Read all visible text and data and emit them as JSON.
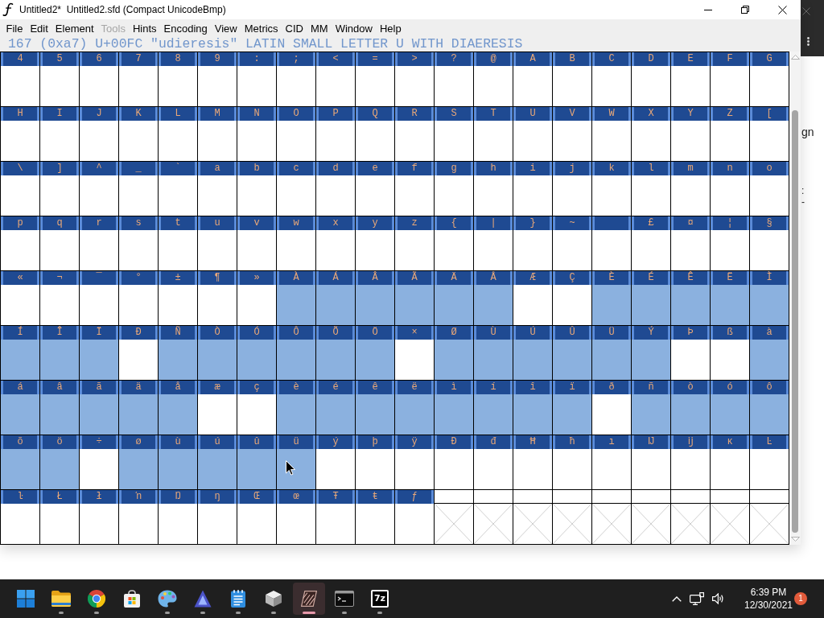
{
  "window": {
    "title": "Untitled2*  Untitled2.sfd (Compact UnicodeBmp)"
  },
  "menu": [
    {
      "label": "File",
      "disabled": false
    },
    {
      "label": "Edit",
      "disabled": false
    },
    {
      "label": "Element",
      "disabled": false
    },
    {
      "label": "Tools",
      "disabled": true
    },
    {
      "label": "Hints",
      "disabled": false
    },
    {
      "label": "Encoding",
      "disabled": false
    },
    {
      "label": "View",
      "disabled": false
    },
    {
      "label": "Metrics",
      "disabled": false
    },
    {
      "label": "CID",
      "disabled": false
    },
    {
      "label": "MM",
      "disabled": false
    },
    {
      "label": "Window",
      "disabled": false
    },
    {
      "label": "Help",
      "disabled": false
    }
  ],
  "glyph_info": "167 (0xa7) U+00FC \"udieresis\" LATIN SMALL LETTER U WITH DIAERESIS",
  "glyph_grid": {
    "rows": [
      {
        "cells": [
          {
            "kind": "glyph",
            "label": "4",
            "selected": false
          },
          {
            "kind": "glyph",
            "label": "5",
            "selected": false
          },
          {
            "kind": "glyph",
            "label": "6",
            "selected": false
          },
          {
            "kind": "glyph",
            "label": "7",
            "selected": false
          },
          {
            "kind": "glyph",
            "label": "8",
            "selected": false
          },
          {
            "kind": "glyph",
            "label": "9",
            "selected": false
          },
          {
            "kind": "glyph",
            "label": ":",
            "selected": false
          },
          {
            "kind": "glyph",
            "label": ";",
            "selected": false
          },
          {
            "kind": "glyph",
            "label": "<",
            "selected": false
          },
          {
            "kind": "glyph",
            "label": "=",
            "selected": false
          },
          {
            "kind": "glyph",
            "label": ">",
            "selected": false
          },
          {
            "kind": "glyph",
            "label": "?",
            "selected": false
          },
          {
            "kind": "glyph",
            "label": "@",
            "selected": false
          },
          {
            "kind": "glyph",
            "label": "A",
            "selected": false
          },
          {
            "kind": "glyph",
            "label": "B",
            "selected": false
          },
          {
            "kind": "glyph",
            "label": "C",
            "selected": false
          },
          {
            "kind": "glyph",
            "label": "D",
            "selected": false
          },
          {
            "kind": "glyph",
            "label": "E",
            "selected": false
          },
          {
            "kind": "glyph",
            "label": "F",
            "selected": false
          },
          {
            "kind": "glyph",
            "label": "G",
            "selected": false
          }
        ]
      },
      {
        "cells": [
          {
            "kind": "glyph",
            "label": "H",
            "selected": false
          },
          {
            "kind": "glyph",
            "label": "I",
            "selected": false
          },
          {
            "kind": "glyph",
            "label": "J",
            "selected": false
          },
          {
            "kind": "glyph",
            "label": "K",
            "selected": false
          },
          {
            "kind": "glyph",
            "label": "L",
            "selected": false
          },
          {
            "kind": "glyph",
            "label": "M",
            "selected": false
          },
          {
            "kind": "glyph",
            "label": "N",
            "selected": false
          },
          {
            "kind": "glyph",
            "label": "O",
            "selected": false
          },
          {
            "kind": "glyph",
            "label": "P",
            "selected": false
          },
          {
            "kind": "glyph",
            "label": "Q",
            "selected": false
          },
          {
            "kind": "glyph",
            "label": "R",
            "selected": false
          },
          {
            "kind": "glyph",
            "label": "S",
            "selected": false
          },
          {
            "kind": "glyph",
            "label": "T",
            "selected": false
          },
          {
            "kind": "glyph",
            "label": "U",
            "selected": false
          },
          {
            "kind": "glyph",
            "label": "V",
            "selected": false
          },
          {
            "kind": "glyph",
            "label": "W",
            "selected": false
          },
          {
            "kind": "glyph",
            "label": "X",
            "selected": false
          },
          {
            "kind": "glyph",
            "label": "Y",
            "selected": false
          },
          {
            "kind": "glyph",
            "label": "Z",
            "selected": false
          },
          {
            "kind": "glyph",
            "label": "[",
            "selected": false
          }
        ]
      },
      {
        "cells": [
          {
            "kind": "glyph",
            "label": "\\",
            "selected": false
          },
          {
            "kind": "glyph",
            "label": "]",
            "selected": false
          },
          {
            "kind": "glyph",
            "label": "^",
            "selected": false
          },
          {
            "kind": "glyph",
            "label": "_",
            "selected": false
          },
          {
            "kind": "glyph",
            "label": "`",
            "selected": false
          },
          {
            "kind": "glyph",
            "label": "a",
            "selected": false
          },
          {
            "kind": "glyph",
            "label": "b",
            "selected": false
          },
          {
            "kind": "glyph",
            "label": "c",
            "selected": false
          },
          {
            "kind": "glyph",
            "label": "d",
            "selected": false
          },
          {
            "kind": "glyph",
            "label": "e",
            "selected": false
          },
          {
            "kind": "glyph",
            "label": "f",
            "selected": false
          },
          {
            "kind": "glyph",
            "label": "g",
            "selected": false
          },
          {
            "kind": "glyph",
            "label": "h",
            "selected": false
          },
          {
            "kind": "glyph",
            "label": "i",
            "selected": false
          },
          {
            "kind": "glyph",
            "label": "j",
            "selected": false
          },
          {
            "kind": "glyph",
            "label": "k",
            "selected": false
          },
          {
            "kind": "glyph",
            "label": "l",
            "selected": false
          },
          {
            "kind": "glyph",
            "label": "m",
            "selected": false
          },
          {
            "kind": "glyph",
            "label": "n",
            "selected": false
          },
          {
            "kind": "glyph",
            "label": "o",
            "selected": false
          }
        ]
      },
      {
        "cells": [
          {
            "kind": "glyph",
            "label": "p",
            "selected": false
          },
          {
            "kind": "glyph",
            "label": "q",
            "selected": false
          },
          {
            "kind": "glyph",
            "label": "r",
            "selected": false
          },
          {
            "kind": "glyph",
            "label": "s",
            "selected": false
          },
          {
            "kind": "glyph",
            "label": "t",
            "selected": false
          },
          {
            "kind": "glyph",
            "label": "u",
            "selected": false
          },
          {
            "kind": "glyph",
            "label": "v",
            "selected": false
          },
          {
            "kind": "glyph",
            "label": "w",
            "selected": false
          },
          {
            "kind": "glyph",
            "label": "x",
            "selected": false
          },
          {
            "kind": "glyph",
            "label": "y",
            "selected": false
          },
          {
            "kind": "glyph",
            "label": "z",
            "selected": false
          },
          {
            "kind": "glyph",
            "label": "{",
            "selected": false
          },
          {
            "kind": "glyph",
            "label": "|",
            "selected": false
          },
          {
            "kind": "glyph",
            "label": "}",
            "selected": false
          },
          {
            "kind": "glyph",
            "label": "~",
            "selected": false
          },
          {
            "kind": "glyph",
            "selected": false
          },
          {
            "kind": "glyph",
            "label": "£",
            "selected": false
          },
          {
            "kind": "glyph",
            "label": "¤",
            "selected": false
          },
          {
            "kind": "glyph",
            "label": "¦",
            "selected": false
          },
          {
            "kind": "glyph",
            "label": "§",
            "selected": false
          }
        ]
      },
      {
        "cells": [
          {
            "kind": "glyph",
            "label": "«",
            "selected": false
          },
          {
            "kind": "glyph",
            "label": "¬",
            "selected": false
          },
          {
            "kind": "glyph",
            "label": "¯",
            "selected": false
          },
          {
            "kind": "glyph",
            "label": "°",
            "selected": false
          },
          {
            "kind": "glyph",
            "label": "±",
            "selected": false
          },
          {
            "kind": "glyph",
            "label": "¶",
            "selected": false
          },
          {
            "kind": "glyph",
            "label": "»",
            "selected": false
          },
          {
            "kind": "glyph",
            "label": "À",
            "selected": true
          },
          {
            "kind": "glyph",
            "label": "Á",
            "selected": true
          },
          {
            "kind": "glyph",
            "label": "Â",
            "selected": true
          },
          {
            "kind": "glyph",
            "label": "Ã",
            "selected": true
          },
          {
            "kind": "glyph",
            "label": "Ä",
            "selected": true
          },
          {
            "kind": "glyph",
            "label": "Å",
            "selected": true
          },
          {
            "kind": "glyph",
            "label": "Æ",
            "selected": false
          },
          {
            "kind": "glyph",
            "label": "Ç",
            "selected": false
          },
          {
            "kind": "glyph",
            "label": "È",
            "selected": true
          },
          {
            "kind": "glyph",
            "label": "É",
            "selected": true
          },
          {
            "kind": "glyph",
            "label": "Ê",
            "selected": true
          },
          {
            "kind": "glyph",
            "label": "Ë",
            "selected": true
          },
          {
            "kind": "glyph",
            "label": "Ì",
            "selected": true
          }
        ]
      },
      {
        "cells": [
          {
            "kind": "glyph",
            "label": "Í",
            "selected": true
          },
          {
            "kind": "glyph",
            "label": "Î",
            "selected": true
          },
          {
            "kind": "glyph",
            "label": "Ï",
            "selected": true
          },
          {
            "kind": "glyph",
            "label": "Ð",
            "selected": false
          },
          {
            "kind": "glyph",
            "label": "Ñ",
            "selected": true
          },
          {
            "kind": "glyph",
            "label": "Ò",
            "selected": true
          },
          {
            "kind": "glyph",
            "label": "Ó",
            "selected": true
          },
          {
            "kind": "glyph",
            "label": "Ô",
            "selected": true
          },
          {
            "kind": "glyph",
            "label": "Õ",
            "selected": true
          },
          {
            "kind": "glyph",
            "label": "Ö",
            "selected": true
          },
          {
            "kind": "glyph",
            "label": "×",
            "selected": false
          },
          {
            "kind": "glyph",
            "label": "Ø",
            "selected": true
          },
          {
            "kind": "glyph",
            "label": "Ù",
            "selected": true
          },
          {
            "kind": "glyph",
            "label": "Ú",
            "selected": true
          },
          {
            "kind": "glyph",
            "label": "Û",
            "selected": true
          },
          {
            "kind": "glyph",
            "label": "Ü",
            "selected": true
          },
          {
            "kind": "glyph",
            "label": "Ý",
            "selected": true
          },
          {
            "kind": "glyph",
            "label": "Þ",
            "selected": false
          },
          {
            "kind": "glyph",
            "label": "ß",
            "selected": false
          },
          {
            "kind": "glyph",
            "label": "à",
            "selected": true
          }
        ]
      },
      {
        "cells": [
          {
            "kind": "glyph",
            "label": "á",
            "selected": true
          },
          {
            "kind": "glyph",
            "label": "â",
            "selected": true
          },
          {
            "kind": "glyph",
            "label": "ã",
            "selected": true
          },
          {
            "kind": "glyph",
            "label": "ä",
            "selected": true
          },
          {
            "kind": "glyph",
            "label": "å",
            "selected": true
          },
          {
            "kind": "glyph",
            "label": "æ",
            "selected": false
          },
          {
            "kind": "glyph",
            "label": "ç",
            "selected": false
          },
          {
            "kind": "glyph",
            "label": "è",
            "selected": true
          },
          {
            "kind": "glyph",
            "label": "é",
            "selected": true
          },
          {
            "kind": "glyph",
            "label": "ê",
            "selected": true
          },
          {
            "kind": "glyph",
            "label": "ë",
            "selected": true
          },
          {
            "kind": "glyph",
            "label": "ì",
            "selected": true
          },
          {
            "kind": "glyph",
            "label": "í",
            "selected": true
          },
          {
            "kind": "glyph",
            "label": "î",
            "selected": true
          },
          {
            "kind": "glyph",
            "label": "ï",
            "selected": true
          },
          {
            "kind": "glyph",
            "label": "ð",
            "selected": false
          },
          {
            "kind": "glyph",
            "label": "ñ",
            "selected": true
          },
          {
            "kind": "glyph",
            "label": "ò",
            "selected": true
          },
          {
            "kind": "glyph",
            "label": "ó",
            "selected": true
          },
          {
            "kind": "glyph",
            "label": "ô",
            "selected": true
          }
        ]
      },
      {
        "cells": [
          {
            "kind": "glyph",
            "label": "õ",
            "selected": true
          },
          {
            "kind": "glyph",
            "label": "ö",
            "selected": true
          },
          {
            "kind": "glyph",
            "label": "÷",
            "selected": false
          },
          {
            "kind": "glyph",
            "label": "ø",
            "selected": true
          },
          {
            "kind": "glyph",
            "label": "ù",
            "selected": true
          },
          {
            "kind": "glyph",
            "label": "ú",
            "selected": true
          },
          {
            "kind": "glyph",
            "label": "û",
            "selected": true
          },
          {
            "kind": "glyph",
            "label": "ü",
            "selected": true
          },
          {
            "kind": "glyph",
            "label": "ý",
            "selected": false
          },
          {
            "kind": "glyph",
            "label": "þ",
            "selected": false
          },
          {
            "kind": "glyph",
            "label": "ÿ",
            "selected": false
          },
          {
            "kind": "glyph",
            "label": "Đ",
            "selected": false
          },
          {
            "kind": "glyph",
            "label": "đ",
            "selected": false
          },
          {
            "kind": "glyph",
            "label": "Ħ",
            "selected": false
          },
          {
            "kind": "glyph",
            "label": "ħ",
            "selected": false
          },
          {
            "kind": "glyph",
            "label": "ı",
            "selected": false
          },
          {
            "kind": "glyph",
            "label": "Ĳ",
            "selected": false
          },
          {
            "kind": "glyph",
            "label": "ĳ",
            "selected": false
          },
          {
            "kind": "glyph",
            "label": "ĸ",
            "selected": false
          },
          {
            "kind": "glyph",
            "label": "Ŀ",
            "selected": false
          }
        ]
      },
      {
        "cells": [
          {
            "kind": "glyph",
            "label": "ŀ",
            "selected": false
          },
          {
            "kind": "glyph",
            "label": "Ł",
            "selected": false
          },
          {
            "kind": "glyph",
            "label": "ł",
            "selected": false
          },
          {
            "kind": "glyph",
            "label": "ŉ",
            "selected": false
          },
          {
            "kind": "glyph",
            "label": "Ŋ",
            "selected": false
          },
          {
            "kind": "glyph",
            "label": "ŋ",
            "selected": false
          },
          {
            "kind": "glyph",
            "label": "Œ",
            "selected": false
          },
          {
            "kind": "glyph",
            "label": "œ",
            "selected": false
          },
          {
            "kind": "glyph",
            "label": "Ŧ",
            "selected": false
          },
          {
            "kind": "glyph",
            "label": "ŧ",
            "selected": false
          },
          {
            "kind": "glyph",
            "label": "ƒ",
            "selected": false
          },
          {
            "kind": "empty",
            "selected": false
          },
          {
            "kind": "empty",
            "selected": false
          },
          {
            "kind": "empty",
            "selected": false
          },
          {
            "kind": "empty",
            "selected": false
          },
          {
            "kind": "empty",
            "selected": false
          },
          {
            "kind": "empty",
            "selected": false
          },
          {
            "kind": "empty",
            "selected": false
          },
          {
            "kind": "empty",
            "selected": false
          },
          {
            "kind": "empty",
            "selected": false
          }
        ]
      }
    ]
  },
  "background_window": {
    "fragments": [
      "gn",
      ":",
      "-"
    ]
  },
  "taskbar": {
    "apps": [
      {
        "kind": "start",
        "running": false,
        "selected": false
      },
      {
        "kind": "files",
        "running": true,
        "selected": false
      },
      {
        "kind": "browser",
        "running": true,
        "selected": false
      },
      {
        "kind": "store",
        "running": false,
        "selected": false
      },
      {
        "kind": "paint",
        "running": true,
        "selected": false
      },
      {
        "kind": "vector",
        "running": true,
        "selected": false
      },
      {
        "kind": "notes",
        "running": true,
        "selected": false
      },
      {
        "kind": "viewer",
        "running": true,
        "selected": false
      },
      {
        "kind": "fontforge",
        "running": true,
        "selected": true
      },
      {
        "kind": "terminal",
        "running": true,
        "selected": false
      },
      {
        "kind": "archiver",
        "label": "7z",
        "running": true,
        "selected": false
      }
    ],
    "tray": {
      "time": "6:39 PM",
      "date": "12/30/2021",
      "notifications": "1"
    }
  }
}
